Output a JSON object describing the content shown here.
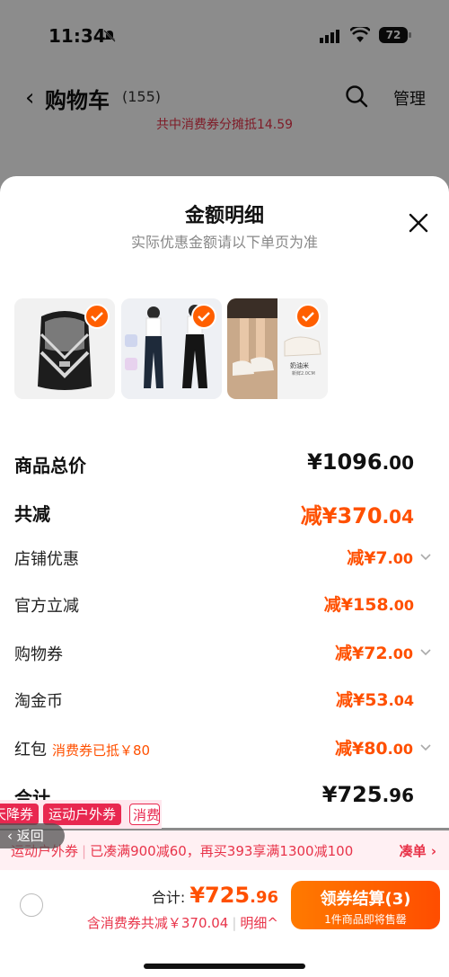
{
  "status": {
    "time": "11:34",
    "battery": "72"
  },
  "nav": {
    "back": "‹",
    "title": "购物车",
    "count": "(155)",
    "manage": "管理"
  },
  "promo_strip": "共中消费券分摊抵14.59",
  "sheet": {
    "title": "金额明细",
    "subtitle": "实际优惠金额请以下单页为准",
    "thumb_caption": "奶油米",
    "thumb_caption2": "新鲜2.0CM"
  },
  "rows": [
    {
      "label": "商品总价",
      "prefix": "",
      "int": "¥1096",
      "dec": ".00"
    },
    {
      "label": "共减",
      "prefix": "",
      "int": "减¥370",
      "dec": ".04"
    },
    {
      "label": "店铺优惠",
      "int": "减¥7",
      "dec": ".00"
    },
    {
      "label": "官方立减",
      "int": "减¥158",
      "dec": ".00"
    },
    {
      "label": "购物券",
      "int": "减¥72",
      "dec": ".00"
    },
    {
      "label": "淘金币",
      "int": "减¥53",
      "dec": ".04"
    },
    {
      "label": "红包",
      "note": "消费券已抵￥80",
      "int": "减¥80",
      "dec": ".00"
    },
    {
      "label": "合计",
      "int": "¥725",
      "dec": ".96"
    }
  ],
  "tags": [
    "天降券",
    "运动户外券",
    "消费"
  ],
  "back_pill": "返回",
  "promo_bar": {
    "category": "运动户外券",
    "message": "已凑满900减60，再买393享满1300减100",
    "link": "凑单 ›"
  },
  "bottom": {
    "total_label": "合计:",
    "total_int": "¥725",
    "total_dec": ".96",
    "saving": "含消费券共减￥370.04",
    "detail": "明细^",
    "checkout_main": "领券结算(3)",
    "checkout_sub": "1件商品即将售罄"
  },
  "colors": {
    "accent": "#ff5000",
    "brand_red": "#e8344a"
  }
}
